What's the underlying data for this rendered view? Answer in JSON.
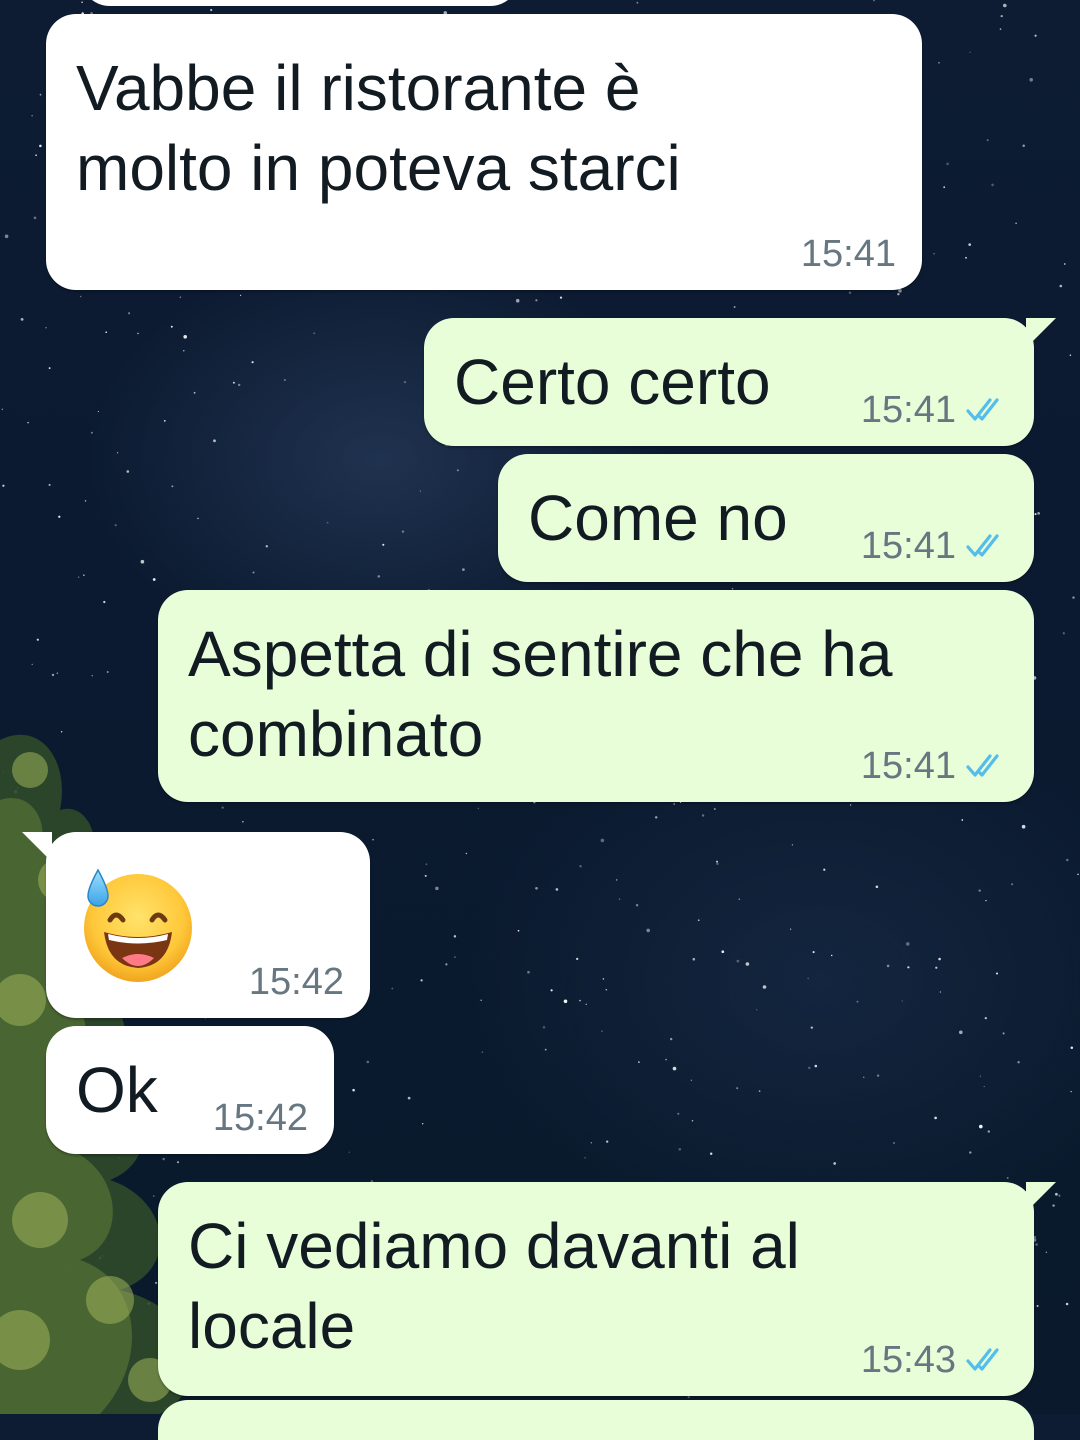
{
  "chat": {
    "messages": [
      {
        "direction": "in",
        "text": "Vabbe il ristorante è\nmolto in poteva starci",
        "time": "15:41"
      },
      {
        "direction": "out",
        "text": "Certo certo",
        "time": "15:41",
        "status": "read"
      },
      {
        "direction": "out",
        "text": "Come no",
        "time": "15:41",
        "status": "read"
      },
      {
        "direction": "out",
        "text": "Aspetta di sentire che ha\ncombinato",
        "time": "15:41",
        "status": "read"
      },
      {
        "direction": "in",
        "emoji": "grinning-face-with-sweat",
        "time": "15:42"
      },
      {
        "direction": "in",
        "text": "Ok",
        "time": "15:42"
      },
      {
        "direction": "out",
        "text": "Ci vediamo davanti al\nlocale",
        "time": "15:43",
        "status": "read"
      }
    ]
  },
  "icons": {
    "read_receipt": "double-check-icon",
    "emoji": "grinning-face-with-sweat-icon"
  },
  "colors": {
    "incoming_bubble": "#ffffff",
    "outgoing_bubble": "#e7fed9",
    "timestamp": "#667781",
    "read_tick": "#53bdeb",
    "wallpaper": "#0c1a2f"
  }
}
